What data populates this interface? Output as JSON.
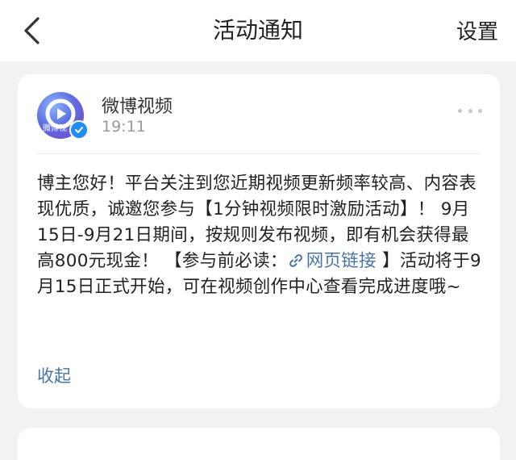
{
  "header": {
    "title": "活动通知",
    "settings_label": "设置"
  },
  "notification": {
    "sender_name": "微博视频",
    "avatar_caption": "微博视",
    "time": "19:11",
    "message_before_link": "博主您好！平台关注到您近期视频更新频率较高、内容表现优质，诚邀您参与【1分钟视频限时激励活动】！ 9月15日-9月21日期间，按规则发布视频，即有机会获得最高800元现金！ 【参与前必读：",
    "link_text": "网页链接",
    "message_after_link": " 】活动将于9月15日正式开始，可在视频创作中心查看完成进度哦~",
    "collapse_label": "收起"
  },
  "colors": {
    "link": "#4a74a8",
    "verified_badge": "#1e8df5",
    "page_background": "#f2f2f2"
  },
  "icons": {
    "back": "chevron-left-icon",
    "more": "more-dots-icon",
    "link": "link-icon",
    "verified": "verified-check-icon"
  }
}
